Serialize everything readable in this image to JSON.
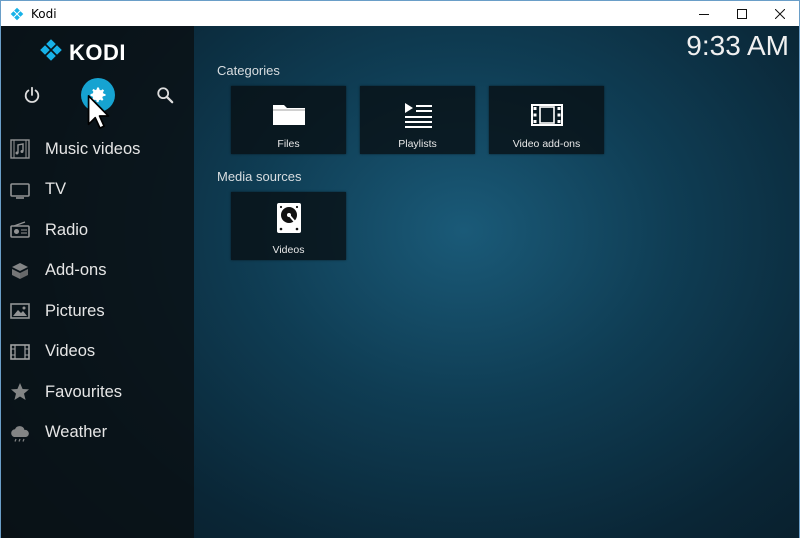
{
  "window": {
    "title": "Kodi",
    "controls": {
      "minimize": "minimize-icon",
      "maximize": "maximize-icon",
      "close": "close-icon"
    }
  },
  "logo": {
    "text": "KODI"
  },
  "top_icons": [
    {
      "name": "power-icon"
    },
    {
      "name": "settings-icon",
      "active": true
    },
    {
      "name": "search-icon"
    }
  ],
  "menu": [
    {
      "label": "Music videos",
      "icon": "music-video-icon"
    },
    {
      "label": "TV",
      "icon": "tv-icon"
    },
    {
      "label": "Radio",
      "icon": "radio-icon"
    },
    {
      "label": "Add-ons",
      "icon": "addons-icon"
    },
    {
      "label": "Pictures",
      "icon": "pictures-icon"
    },
    {
      "label": "Videos",
      "icon": "film-icon"
    },
    {
      "label": "Favourites",
      "icon": "star-icon"
    },
    {
      "label": "Weather",
      "icon": "weather-icon"
    }
  ],
  "clock": "9:33 AM",
  "categories": {
    "label": "Categories",
    "tiles": [
      {
        "label": "Files",
        "icon": "folder-icon"
      },
      {
        "label": "Playlists",
        "icon": "playlist-icon"
      },
      {
        "label": "Video add-ons",
        "icon": "film-icon"
      }
    ]
  },
  "media_sources": {
    "label": "Media sources",
    "tiles": [
      {
        "label": "Videos",
        "icon": "harddisk-icon"
      }
    ]
  },
  "colors": {
    "accent": "#16a3d1",
    "sidebar_bg": "#0a1014",
    "background": "#0f3d54"
  }
}
